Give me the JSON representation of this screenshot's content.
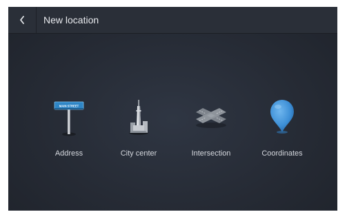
{
  "header": {
    "title": "New location",
    "back_icon": "chevron-left-icon"
  },
  "options": [
    {
      "label": "Address",
      "icon": "street-sign-icon",
      "sign_text": "MAIN STREET"
    },
    {
      "label": "City center",
      "icon": "city-tower-icon"
    },
    {
      "label": "Intersection",
      "icon": "intersection-icon"
    },
    {
      "label": "Coordinates",
      "icon": "map-pin-icon"
    }
  ],
  "colors": {
    "background": "#262b35",
    "header": "#2a2f38",
    "sign_blue": "#2f86c6",
    "pin_blue": "#3d8fd6",
    "text": "#d5d8de"
  }
}
